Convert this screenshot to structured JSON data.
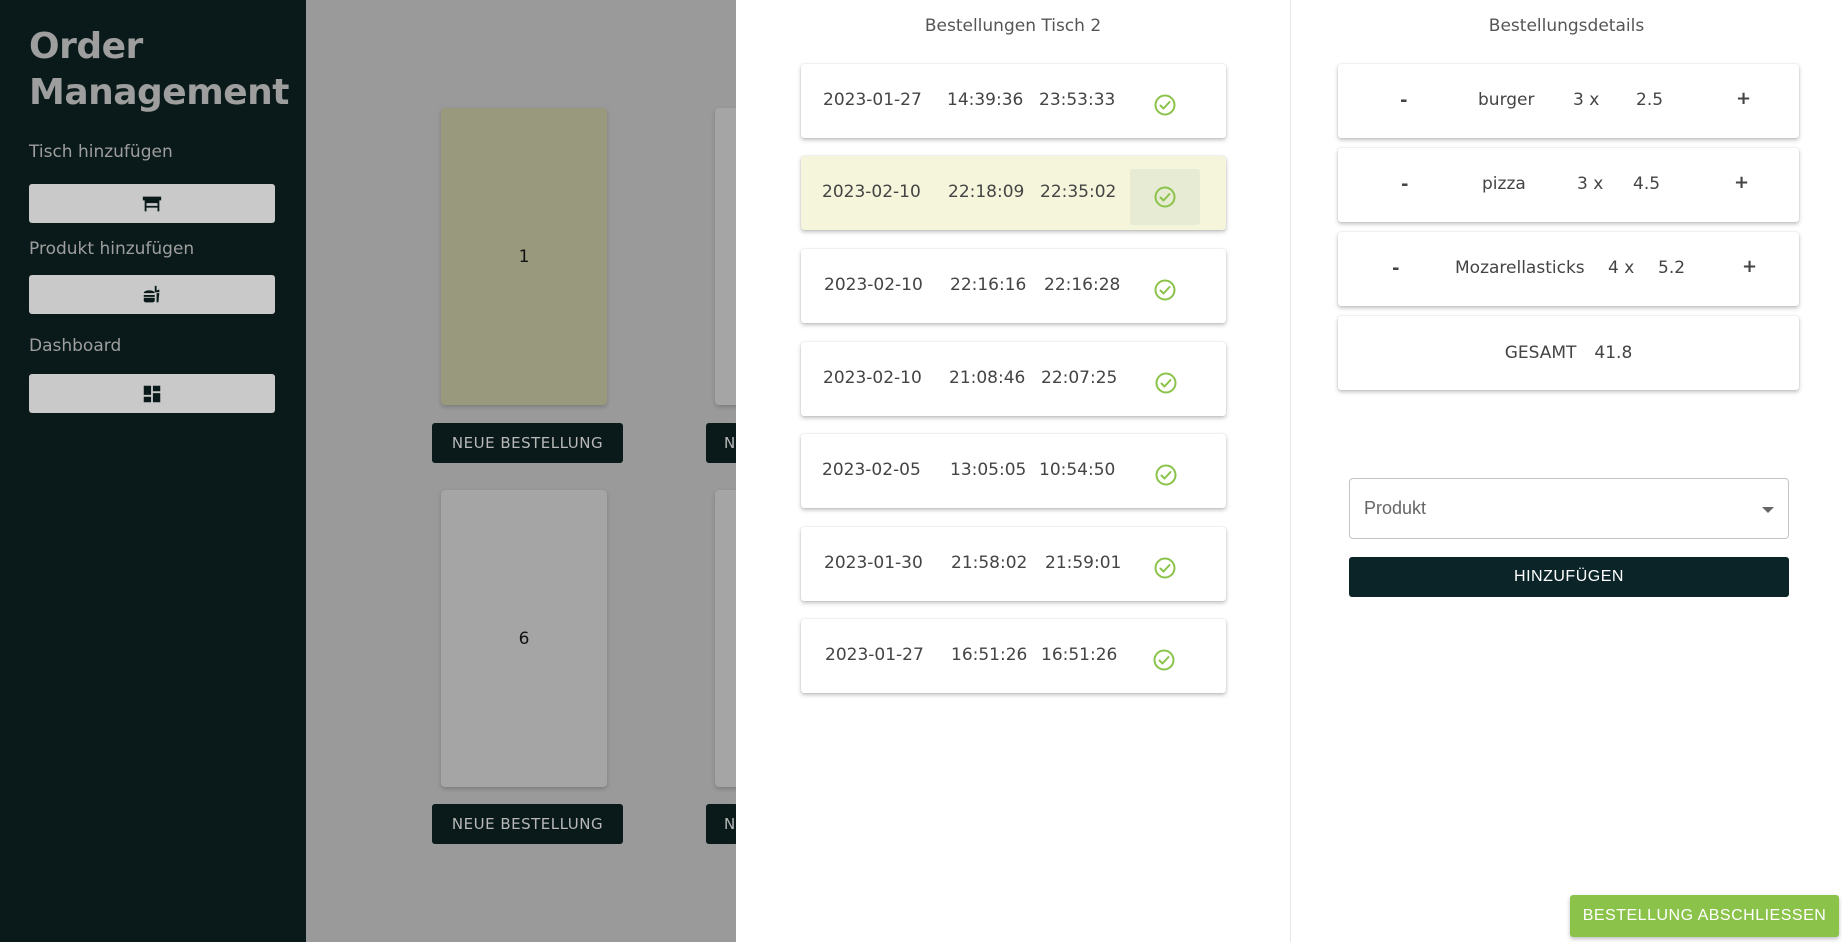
{
  "sidebar": {
    "title_line1": "Order",
    "title_line2": "Management",
    "items": [
      {
        "label": "Tisch hinzufügen",
        "icon": "table-icon"
      },
      {
        "label": "Produkt hinzufügen",
        "icon": "food-icon"
      },
      {
        "label": "Dashboard",
        "icon": "dashboard-icon"
      }
    ]
  },
  "tables": [
    {
      "number": "1",
      "button": "NEUE BESTELLUNG"
    },
    {
      "number": "",
      "button": "NEUE BESTELLUNG"
    },
    {
      "number": "6",
      "button": "NEUE BESTELLUNG"
    },
    {
      "number": "",
      "button": "NEUE BESTELLUNG"
    }
  ],
  "orders_panel": {
    "title": "Bestellungen Tisch 2",
    "orders": [
      {
        "date": "2023-01-27",
        "start": "14:39:36",
        "end": "23:53:33",
        "selected": false
      },
      {
        "date": "2023-02-10",
        "start": "22:18:09",
        "end": "22:35:02",
        "selected": true
      },
      {
        "date": "2023-02-10",
        "start": "22:16:16",
        "end": "22:16:28",
        "selected": false
      },
      {
        "date": "2023-02-10",
        "start": "21:08:46",
        "end": "22:07:25",
        "selected": false
      },
      {
        "date": "2023-02-05",
        "start": "13:05:05",
        "end": "10:54:50",
        "selected": false
      },
      {
        "date": "2023-01-30",
        "start": "21:58:02",
        "end": "21:59:01",
        "selected": false
      },
      {
        "date": "2023-01-27",
        "start": "16:51:26",
        "end": "16:51:26",
        "selected": false
      }
    ]
  },
  "details_panel": {
    "title": "Bestellungsdetails",
    "items": [
      {
        "minus": "-",
        "name": "burger",
        "qty": "3 x",
        "price": "2.5",
        "plus": "+"
      },
      {
        "minus": "-",
        "name": "pizza",
        "qty": "3 x",
        "price": "4.5",
        "plus": "+"
      },
      {
        "minus": "-",
        "name": "Mozarellasticks",
        "qty": "4 x",
        "price": "5.2",
        "plus": "+"
      }
    ],
    "total_label": "GESAMT",
    "total_value": "41.8",
    "product_select_placeholder": "Produkt",
    "add_button": "HINZUFÜGEN",
    "finish_button": "BESTELLUNG ABSCHLIESSEN"
  },
  "colors": {
    "sidebar_bg": "#0a1a1a",
    "accent_green": "#8bc34a",
    "selected_row": "#f5f5dc"
  }
}
